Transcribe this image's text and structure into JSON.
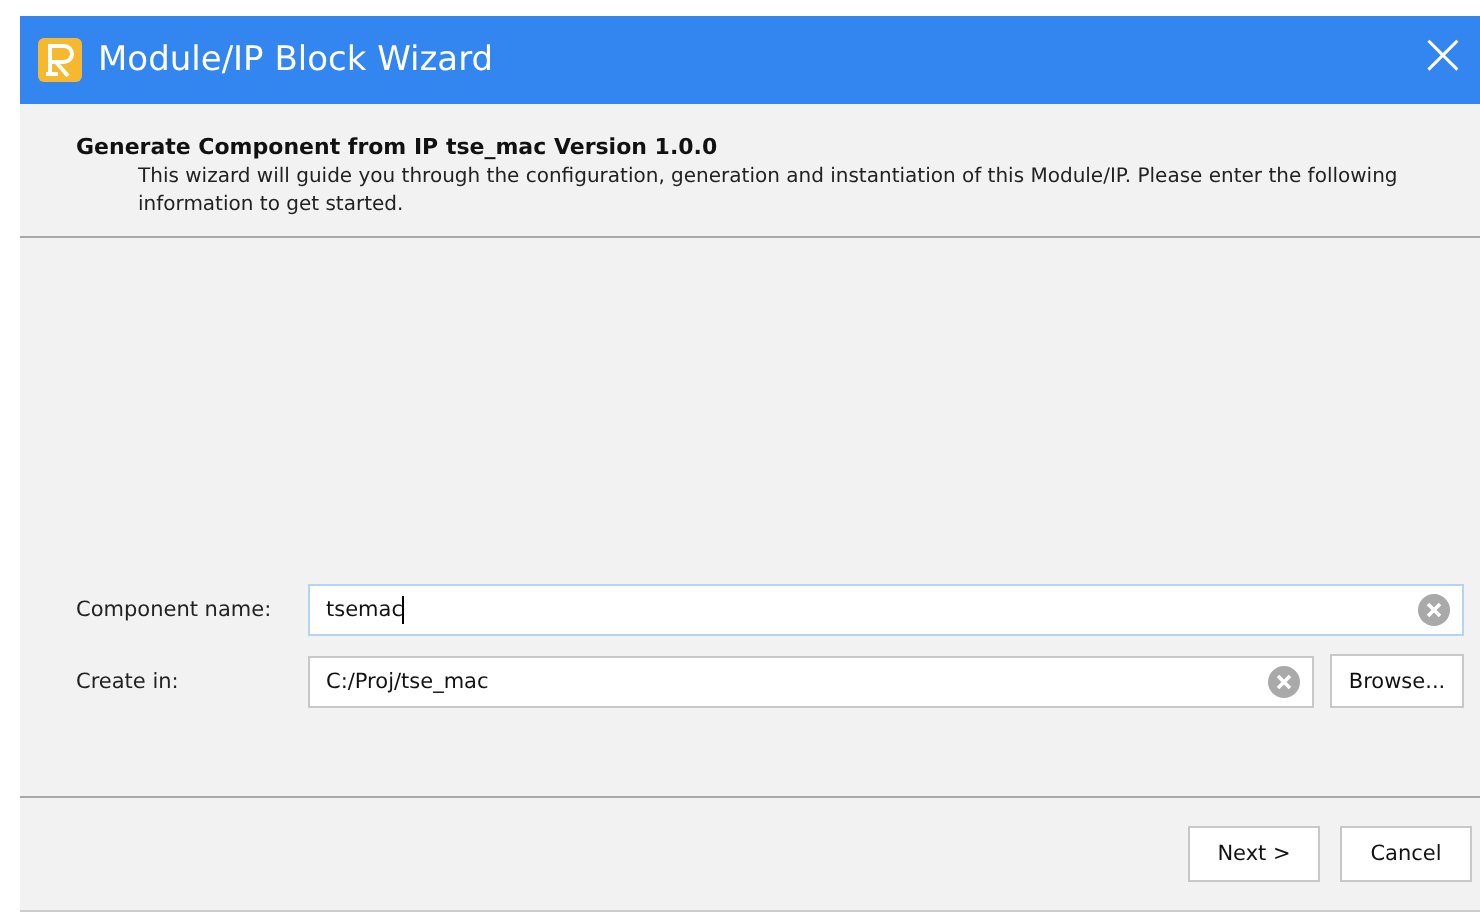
{
  "window": {
    "title": "Module/IP Block Wizard",
    "close": "×"
  },
  "header": {
    "title": "Generate Component from IP tse_mac Version 1.0.0",
    "description": "This wizard will guide you through the configuration, generation and instantiation of this Module/IP. Please enter the following information to get started."
  },
  "fields": [
    {
      "label": "Component name:",
      "value": "tsemac",
      "focused": true,
      "browse": false
    },
    {
      "label": "Create in:",
      "value": "C:/Proj/tse_mac",
      "focused": false,
      "browse": true,
      "browse_label": "Browse..."
    }
  ],
  "buttons": [
    "Next >",
    "Cancel"
  ]
}
